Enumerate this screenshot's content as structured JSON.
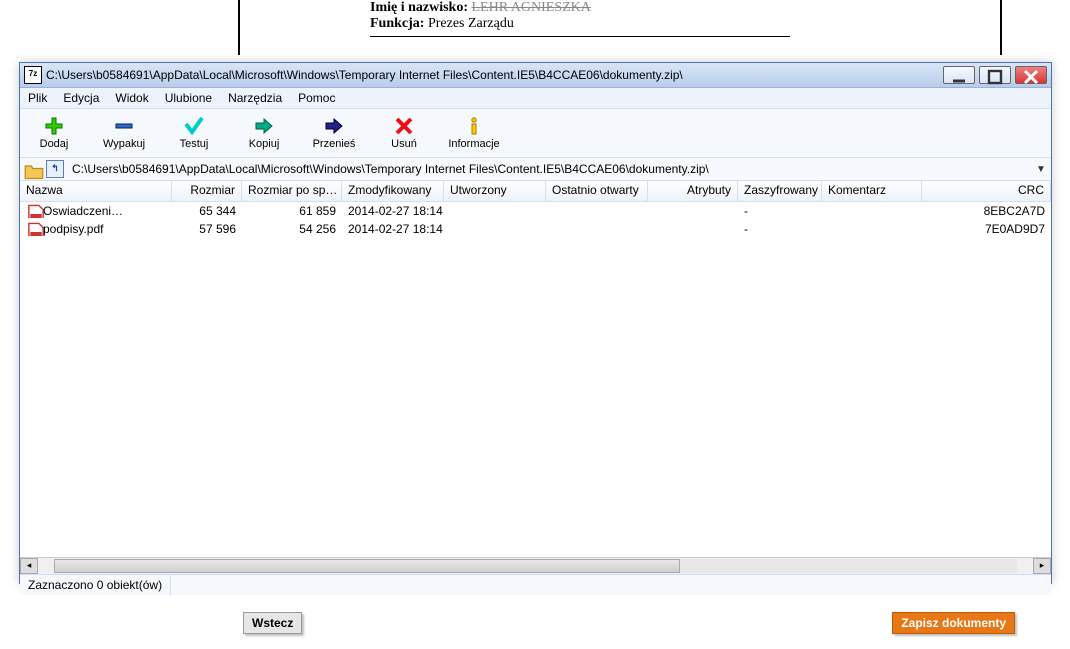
{
  "doc": {
    "line1_label": "Imię i nazwisko:",
    "line1_val": "LEHR AGNIESZKA",
    "line2_label": "Funkcja:",
    "line2_val": "Prezes Zarządu"
  },
  "window": {
    "title": "C:\\Users\\b0584691\\AppData\\Local\\Microsoft\\Windows\\Temporary Internet Files\\Content.IE5\\B4CCAE06\\dokumenty.zip\\",
    "icon_text": "7z"
  },
  "menu": [
    "Plik",
    "Edycja",
    "Widok",
    "Ulubione",
    "Narzędzia",
    "Pomoc"
  ],
  "toolbar": {
    "add": "Dodaj",
    "extract": "Wypakuj",
    "test": "Testuj",
    "copy": "Kopiuj",
    "move": "Przenieś",
    "delete": "Usuń",
    "info": "Informacje"
  },
  "address": "C:\\Users\\b0584691\\AppData\\Local\\Microsoft\\Windows\\Temporary Internet Files\\Content.IE5\\B4CCAE06\\dokumenty.zip\\",
  "columns": {
    "name": "Nazwa",
    "size": "Rozmiar",
    "packed": "Rozmiar po sp…",
    "mod": "Zmodyfikowany",
    "created": "Utworzony",
    "opened": "Ostatnio otwarty",
    "attr": "Atrybuty",
    "enc": "Zaszyfrowany",
    "comment": "Komentarz",
    "crc": "CRC"
  },
  "files": [
    {
      "name": "Oswiadczeni…",
      "size": "65 344",
      "packed": "61 859",
      "mod": "2014-02-27 18:14",
      "created": "",
      "opened": "",
      "attr": "",
      "enc": "-",
      "comment": "",
      "crc": "8EBC2A7D"
    },
    {
      "name": "podpisy.pdf",
      "size": "57 596",
      "packed": "54 256",
      "mod": "2014-02-27 18:14",
      "created": "",
      "opened": "",
      "attr": "",
      "enc": "-",
      "comment": "",
      "crc": "7E0AD9D7"
    }
  ],
  "status": "Zaznaczono 0 obiekt(ów)",
  "page": {
    "back": "Wstecz",
    "save": "Zapisz dokumenty"
  }
}
